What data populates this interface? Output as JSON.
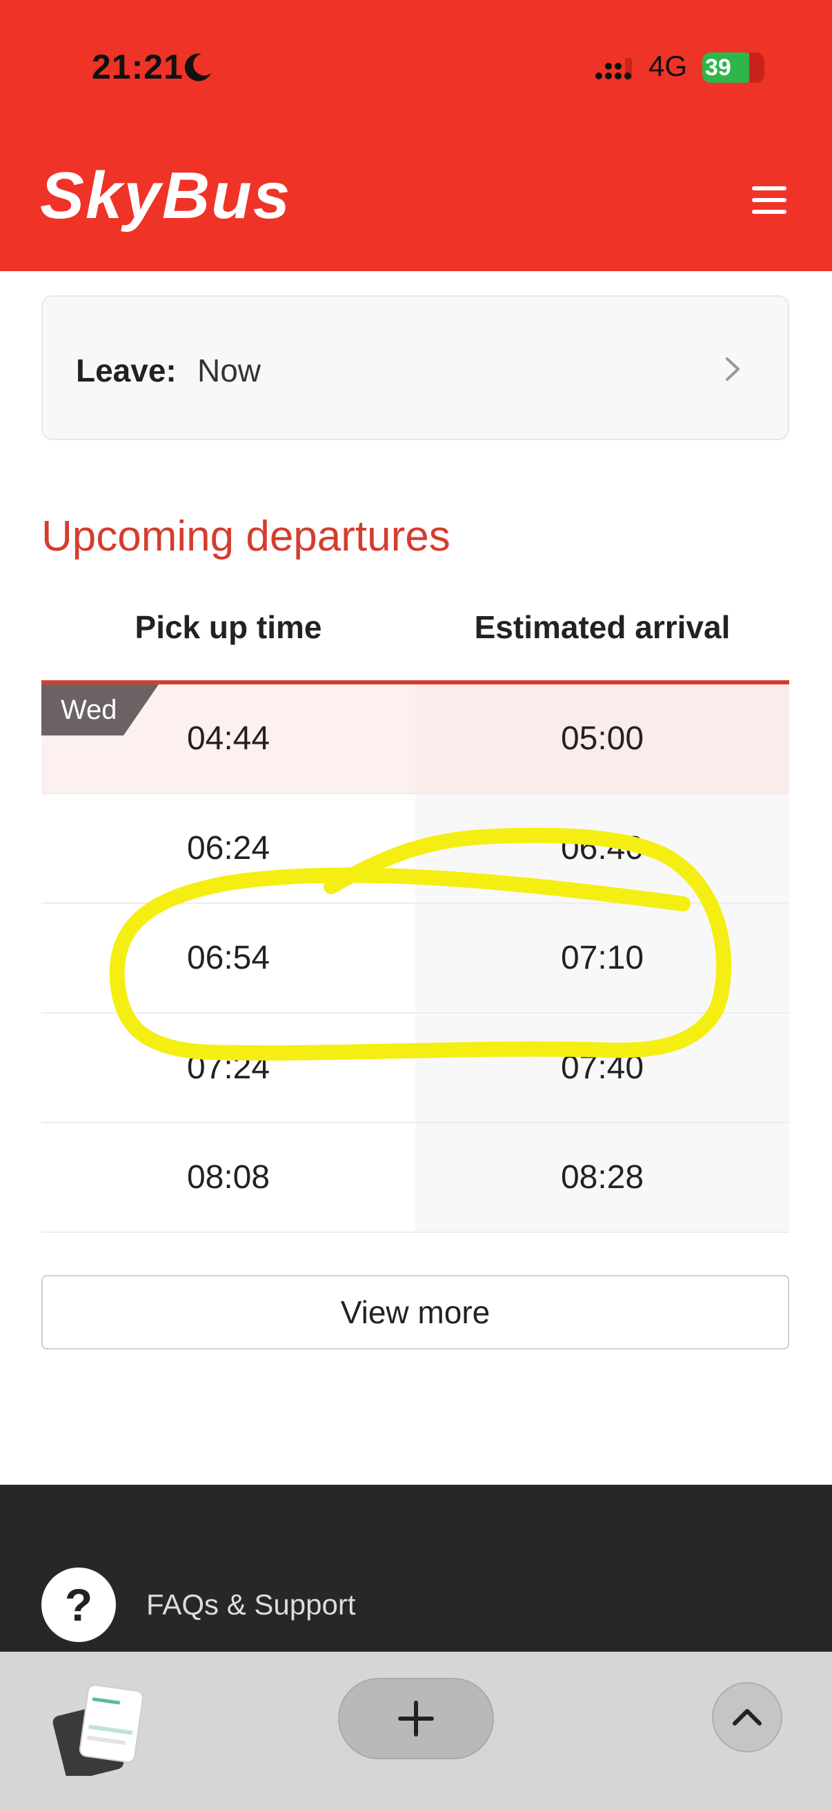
{
  "status_bar": {
    "time": "21:21",
    "network": "4G",
    "battery": "39"
  },
  "header": {
    "logo_text": "SkyBus",
    "brand_color": "#ef3327"
  },
  "leave": {
    "label": "Leave:",
    "value": "Now"
  },
  "departures": {
    "title": "Upcoming departures",
    "columns": [
      "Pick up time",
      "Estimated arrival"
    ],
    "day_badge": "Wed",
    "rows": [
      {
        "pickup": "04:44",
        "arrival": "05:00"
      },
      {
        "pickup": "06:24",
        "arrival": "06:40"
      },
      {
        "pickup": "06:54",
        "arrival": "07:10"
      },
      {
        "pickup": "07:24",
        "arrival": "07:40"
      },
      {
        "pickup": "08:08",
        "arrival": "08:28"
      }
    ],
    "view_more_label": "View more"
  },
  "footer": {
    "faq_icon": "?",
    "faq_label": "FAQs & Support"
  },
  "annotation": {
    "color": "#f5ee12"
  }
}
